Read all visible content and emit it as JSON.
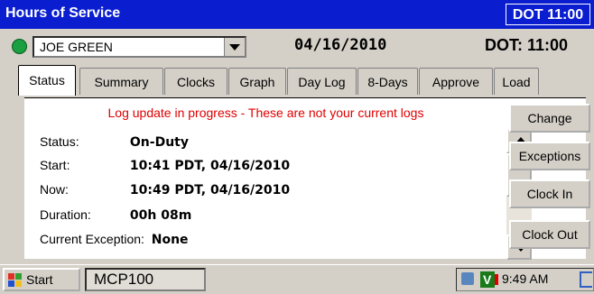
{
  "window": {
    "title": "Hours of Service",
    "dot_badge": "DOT 11:00"
  },
  "driver": {
    "name": "JOE GREEN",
    "status_color": "#1aa040"
  },
  "date": "04/16/2010",
  "dot_clock": "DOT: 11:00",
  "tabs": [
    {
      "label": "Status",
      "active": true
    },
    {
      "label": "Summary"
    },
    {
      "label": "Clocks"
    },
    {
      "label": "Graph"
    },
    {
      "label": "Day Log"
    },
    {
      "label": "8-Days"
    },
    {
      "label": "Approve"
    },
    {
      "label": "Load"
    }
  ],
  "status": {
    "warning": "Log update in progress - These are not your current logs",
    "warning_color": "#e00000",
    "rows": [
      {
        "label": "Status:",
        "value": "On-Duty"
      },
      {
        "label": "Start:",
        "value": "10:41 PDT, 04/16/2010"
      },
      {
        "label": "Now:",
        "value": "10:49 PDT, 04/16/2010"
      },
      {
        "label": "Duration:",
        "value": "00h 08m"
      },
      {
        "label": "Current Exception:",
        "value": "None"
      }
    ]
  },
  "side_buttons": [
    "Change",
    "Exceptions",
    "Clock In",
    "Clock Out"
  ],
  "taskbar": {
    "start_label": "Start",
    "app_label": "MCP100",
    "time": "9:49 AM",
    "tray_app_letter": "V"
  }
}
